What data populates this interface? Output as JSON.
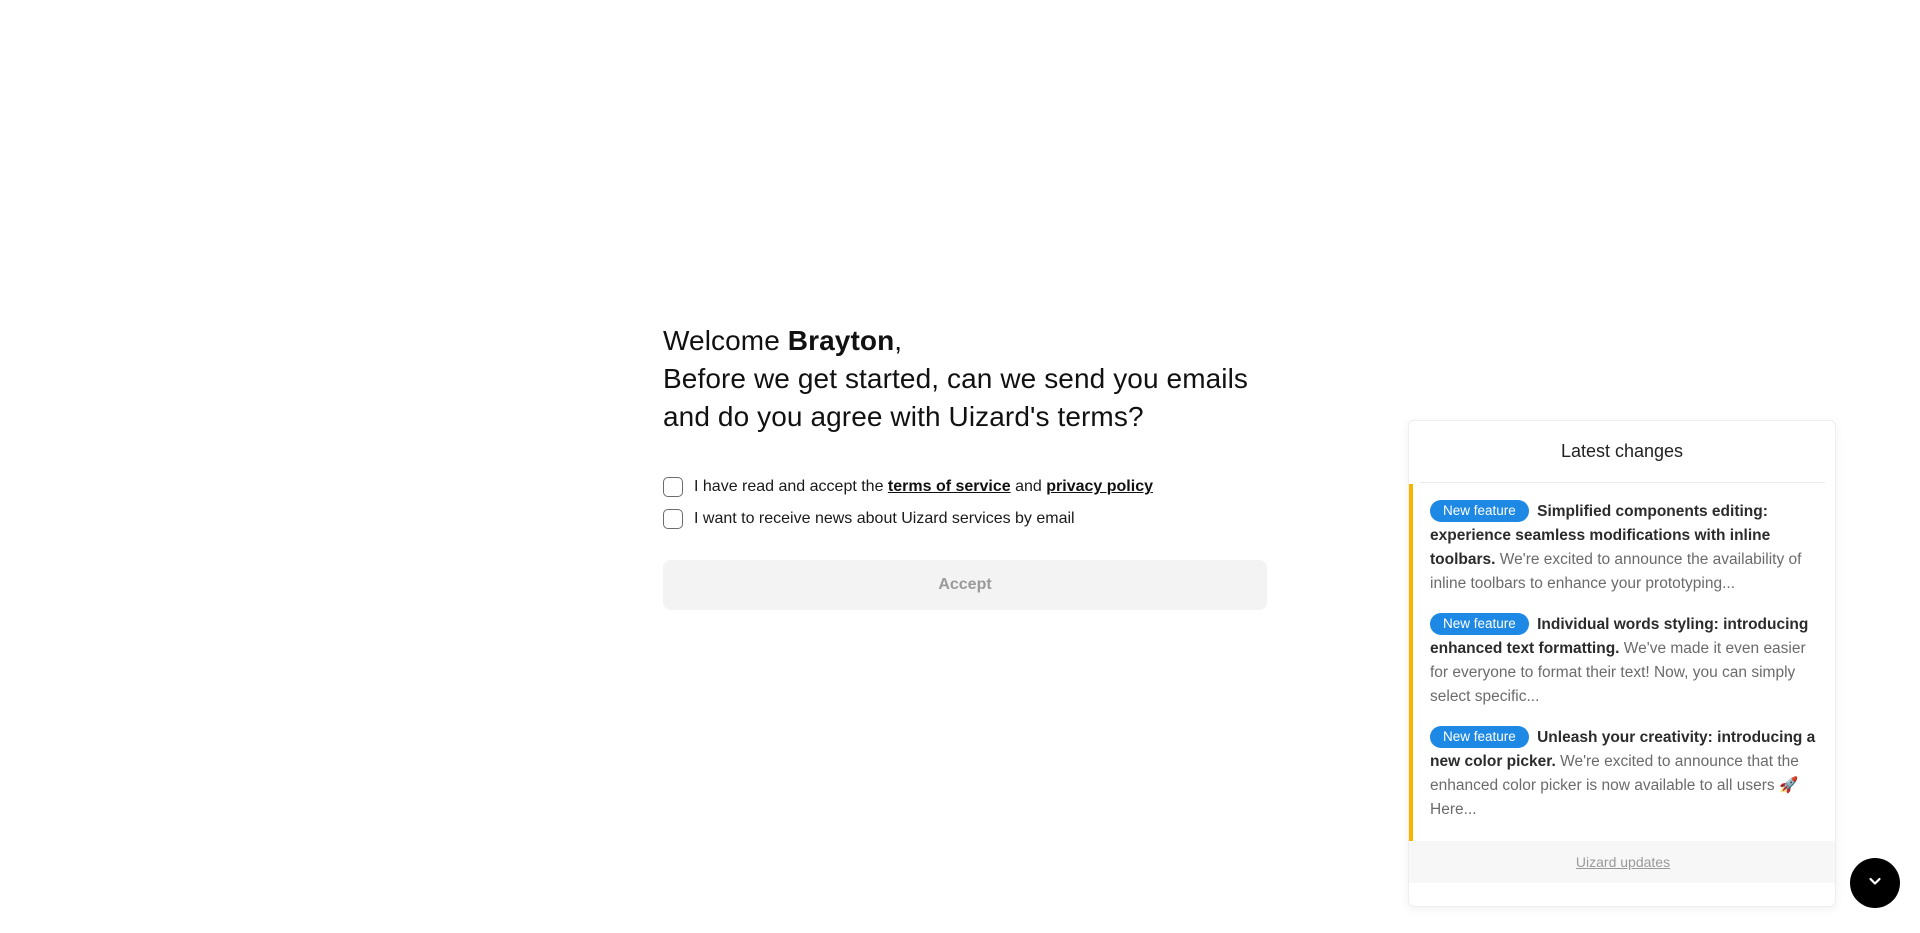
{
  "welcome": {
    "greeting": "Welcome",
    "name": "Brayton",
    "name_suffix": ",",
    "question": "Before we get started, can we send you emails and do you agree with Uizard's terms?"
  },
  "consent": {
    "terms_prefix": "I have read and accept the",
    "terms_link": "terms of service",
    "terms_and": "and",
    "privacy_link": "privacy policy",
    "terms_checked": false,
    "news_label": "I want to receive news about Uizard services by email",
    "news_checked": false,
    "accept_label": "Accept",
    "accept_enabled": false
  },
  "changes_panel": {
    "title": "Latest changes",
    "accent_color": "#f7b500",
    "badge_color": "#1e88e5",
    "items": [
      {
        "badge": "New feature",
        "title": "Simplified components editing: experience seamless modifications with inline toolbars.",
        "description": "We're excited to announce the availability of inline toolbars to enhance your prototyping..."
      },
      {
        "badge": "New feature",
        "title": "Individual words styling: introducing enhanced text formatting.",
        "description": "We've made it even easier for everyone to format their text! Now, you can simply select specific..."
      },
      {
        "badge": "New feature",
        "title": "Unleash your creativity: introducing a new color picker.",
        "description": "We're excited to announce that the enhanced color picker is now available to all users 🚀 Here..."
      }
    ],
    "footer_link": "Uizard updates"
  },
  "fab": {
    "icon": "chevron-down-icon"
  }
}
